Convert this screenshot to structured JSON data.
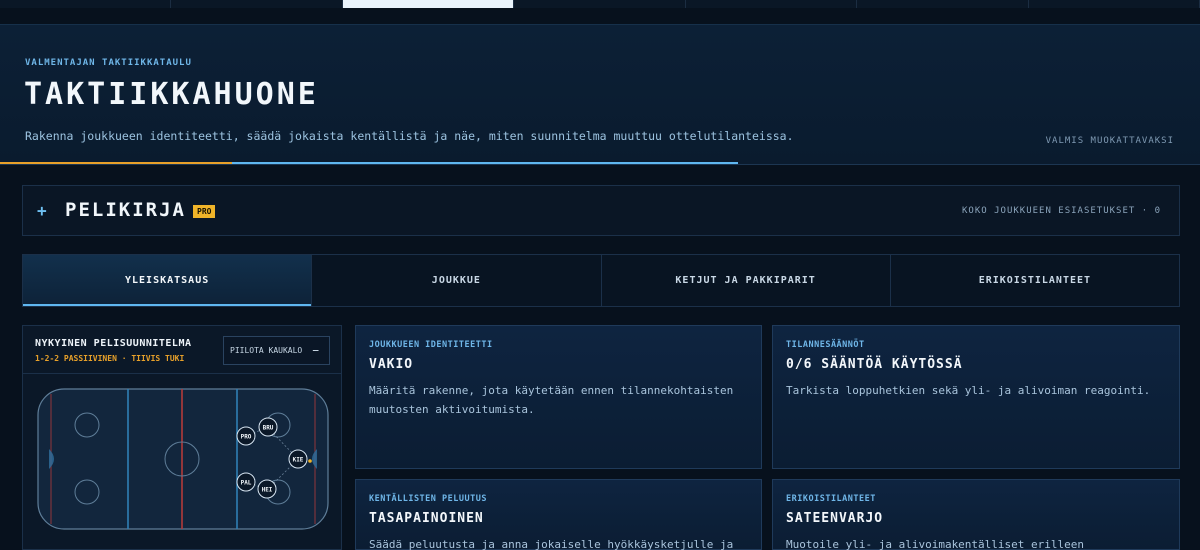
{
  "hero": {
    "eyebrow": "VALMENTAJAN TAKTIIKKATAULU",
    "title": "TAKTIIKKAHUONE",
    "description": "Rakenna joukkueen identiteetti, säädä jokaista kentällistä ja näe, miten suunnitelma muuttuu ottelutilanteissa.",
    "status": "VALMIS MUOKATTAVAKSI"
  },
  "playbook": {
    "title": "PELIKIRJA",
    "badge": "PRO",
    "presets": "KOKO JOUKKUEEN ESIASETUKSET · 0"
  },
  "tabs": [
    {
      "label": "YLEISKATSAUS"
    },
    {
      "label": "JOUKKUE"
    },
    {
      "label": "KETJUT JA PAKKIPARIT"
    },
    {
      "label": "ERIKOISTILANTEET"
    }
  ],
  "plan": {
    "title": "NYKYINEN PELISUUNNITELMA",
    "subtitle": "1-2-2 PASSIIVINEN · TIIVIS TUKI",
    "toggle_label": "PIILOTA KAUKALO",
    "toggle_icon": "−",
    "players": [
      {
        "label": "PRO"
      },
      {
        "label": "BRU"
      },
      {
        "label": "KIE"
      },
      {
        "label": "PAL"
      },
      {
        "label": "HEI"
      }
    ]
  },
  "cards": [
    {
      "eyebrow": "JOUKKUEEN IDENTITEETTI",
      "title": "VAKIO",
      "description": "Määritä rakenne, jota käytetään ennen tilannekohtaisten muutosten aktivoitumista."
    },
    {
      "eyebrow": "TILANNESÄÄNNÖT",
      "title": "0/6 SÄÄNTÖÄ KÄYTÖSSÄ",
      "description": "Tarkista loppuhetkien sekä yli- ja alivoiman reagointi."
    },
    {
      "eyebrow": "KENTÄLLISTEN PELUUTUS",
      "title": "TASAPAINOINEN",
      "description": "Säädä peluutusta ja anna jokaiselle hyökkäysketjulle ja"
    },
    {
      "eyebrow": "ERIKOISTILANTEET",
      "title": "SATEENVARJO",
      "description": "Muotoile yli- ja alivoimakentälliset erilleen"
    }
  ],
  "colors": {
    "accent_blue": "#5fb7f0",
    "accent_amber": "#e8a12a",
    "badge_yellow": "#f0b429",
    "blue_line": "#2f7fb5",
    "red_line": "#b23a3a"
  }
}
